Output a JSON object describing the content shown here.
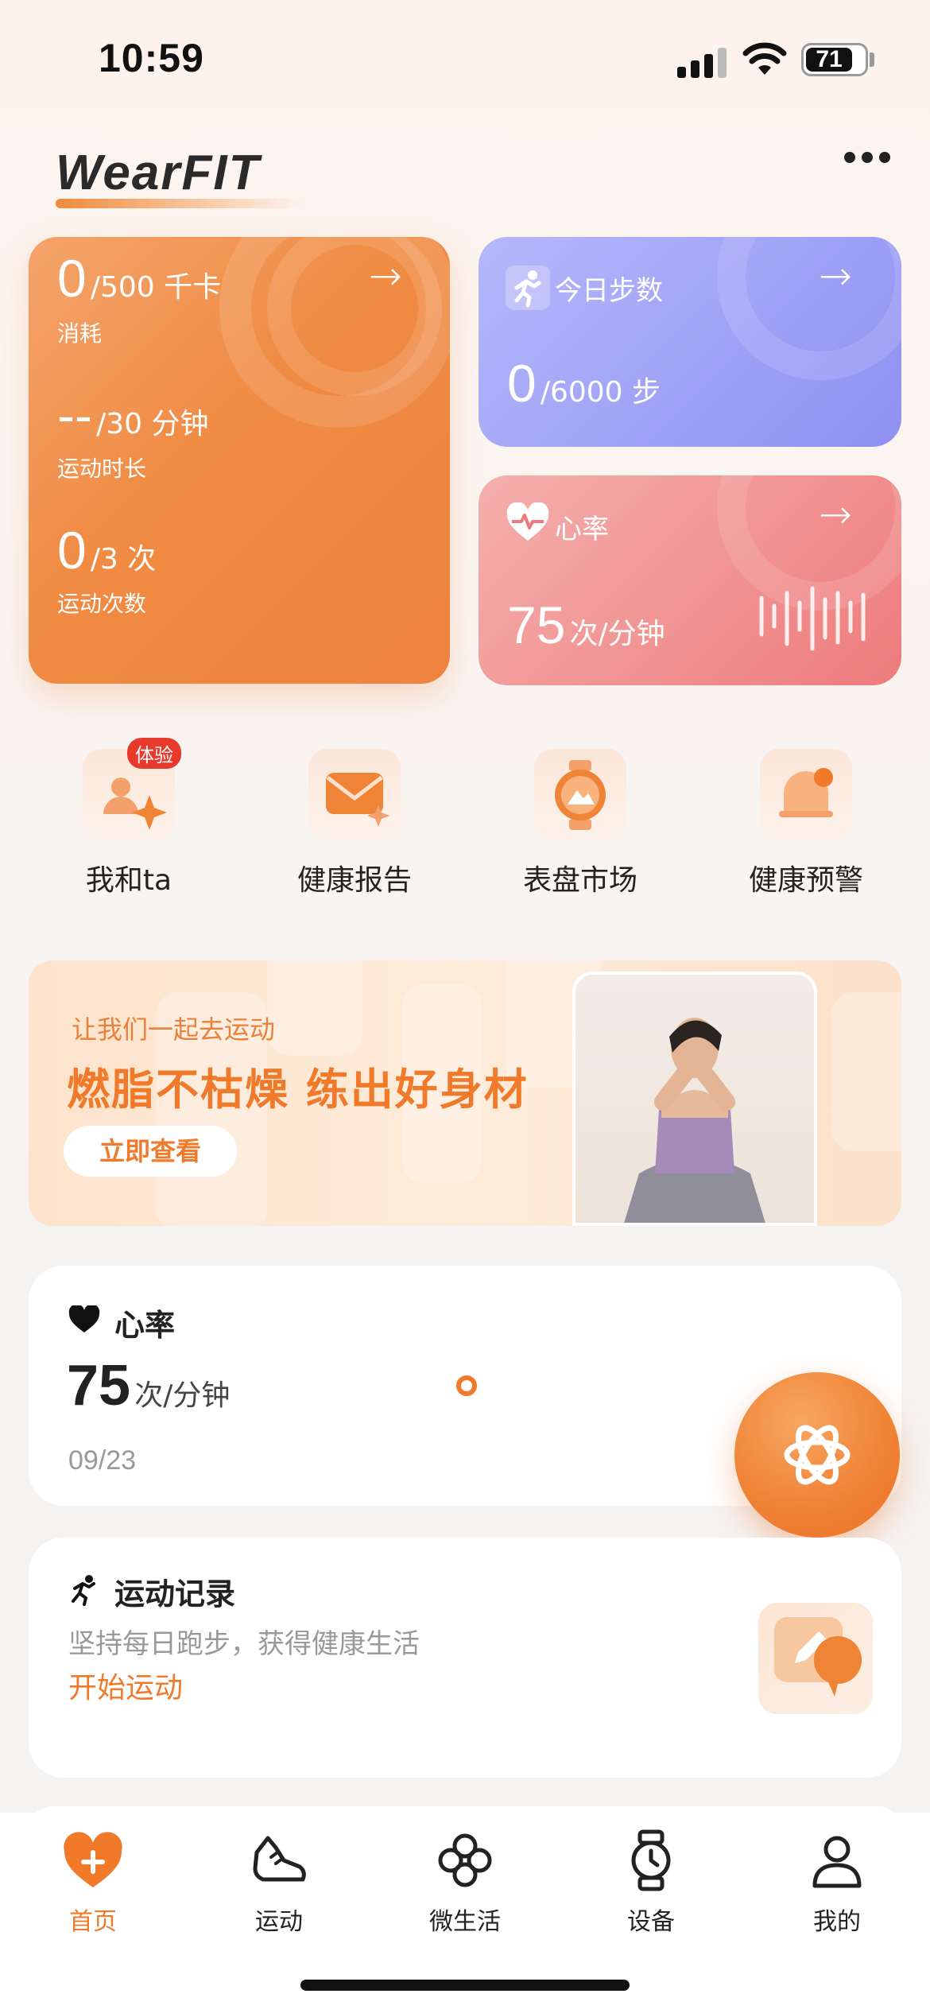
{
  "status_bar": {
    "time": "10:59",
    "battery": "71"
  },
  "header": {
    "logo_text": "WearFIT"
  },
  "calorie_card": {
    "calories_value": "0",
    "calories_goal": "/500 千卡",
    "calories_label": "消耗",
    "duration_value": "--",
    "duration_goal": "/30 分钟",
    "duration_label": "运动时长",
    "count_value": "0",
    "count_goal": "/3 次",
    "count_label": "运动次数"
  },
  "steps_card": {
    "title": "今日步数",
    "value": "0",
    "goal": "/6000 步"
  },
  "heart_card": {
    "title": "心率",
    "value": "75",
    "unit": "次/分钟"
  },
  "quick_actions": [
    {
      "label": "我和ta",
      "badge": "体验"
    },
    {
      "label": "健康报告"
    },
    {
      "label": "表盘市场"
    },
    {
      "label": "健康预警"
    }
  ],
  "banner": {
    "subtitle": "让我们一起去运动",
    "title": "燃脂不枯燥  练出好身材",
    "button": "立即查看"
  },
  "heart_rate_section": {
    "title": "心率",
    "value": "75",
    "unit": "次/分钟",
    "date": "09/23"
  },
  "exercise_section": {
    "title": "运动记录",
    "desc": "坚持每日跑步，获得健康生活",
    "cta": "开始运动"
  },
  "tabs": [
    {
      "label": "首页",
      "icon": "home-heart-icon",
      "active": true
    },
    {
      "label": "运动",
      "icon": "shoe-icon"
    },
    {
      "label": "微生活",
      "icon": "clover-icon"
    },
    {
      "label": "设备",
      "icon": "watch-icon"
    },
    {
      "label": "我的",
      "icon": "profile-icon"
    }
  ],
  "colors": {
    "accent": "#f07a2a",
    "steps": "#8f90f2",
    "heart": "#ee7b7c"
  }
}
